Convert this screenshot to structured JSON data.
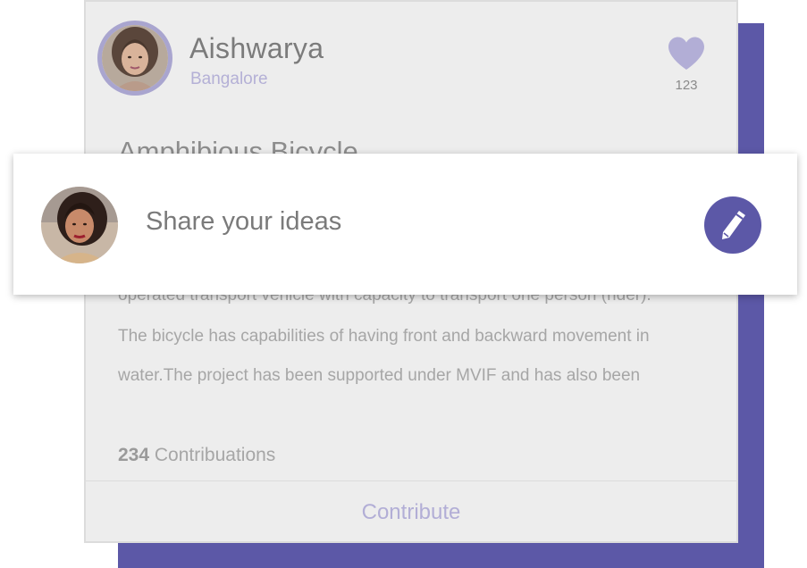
{
  "profile": {
    "name": "Aishwarya",
    "location": "Bangalore",
    "likes": "123"
  },
  "idea": {
    "title": "Amphibious Bicycle",
    "description_lines": [
      "operated transport vehicle with capacity to transport one person (rider).",
      "The bicycle has capabilities of having front and backward movement in",
      "water.The project has been supported under MVIF and has also been"
    ],
    "contributions_count": "234",
    "contributions_label": "Contribuations"
  },
  "card": {
    "contribute_label": "Contribute"
  },
  "share": {
    "placeholder": "Share your ideas"
  },
  "colors": {
    "accent": "#5c58a7",
    "accent_light": "#b2aed6"
  },
  "icons": {
    "like": "heart-icon",
    "edit": "pencil-icon"
  }
}
